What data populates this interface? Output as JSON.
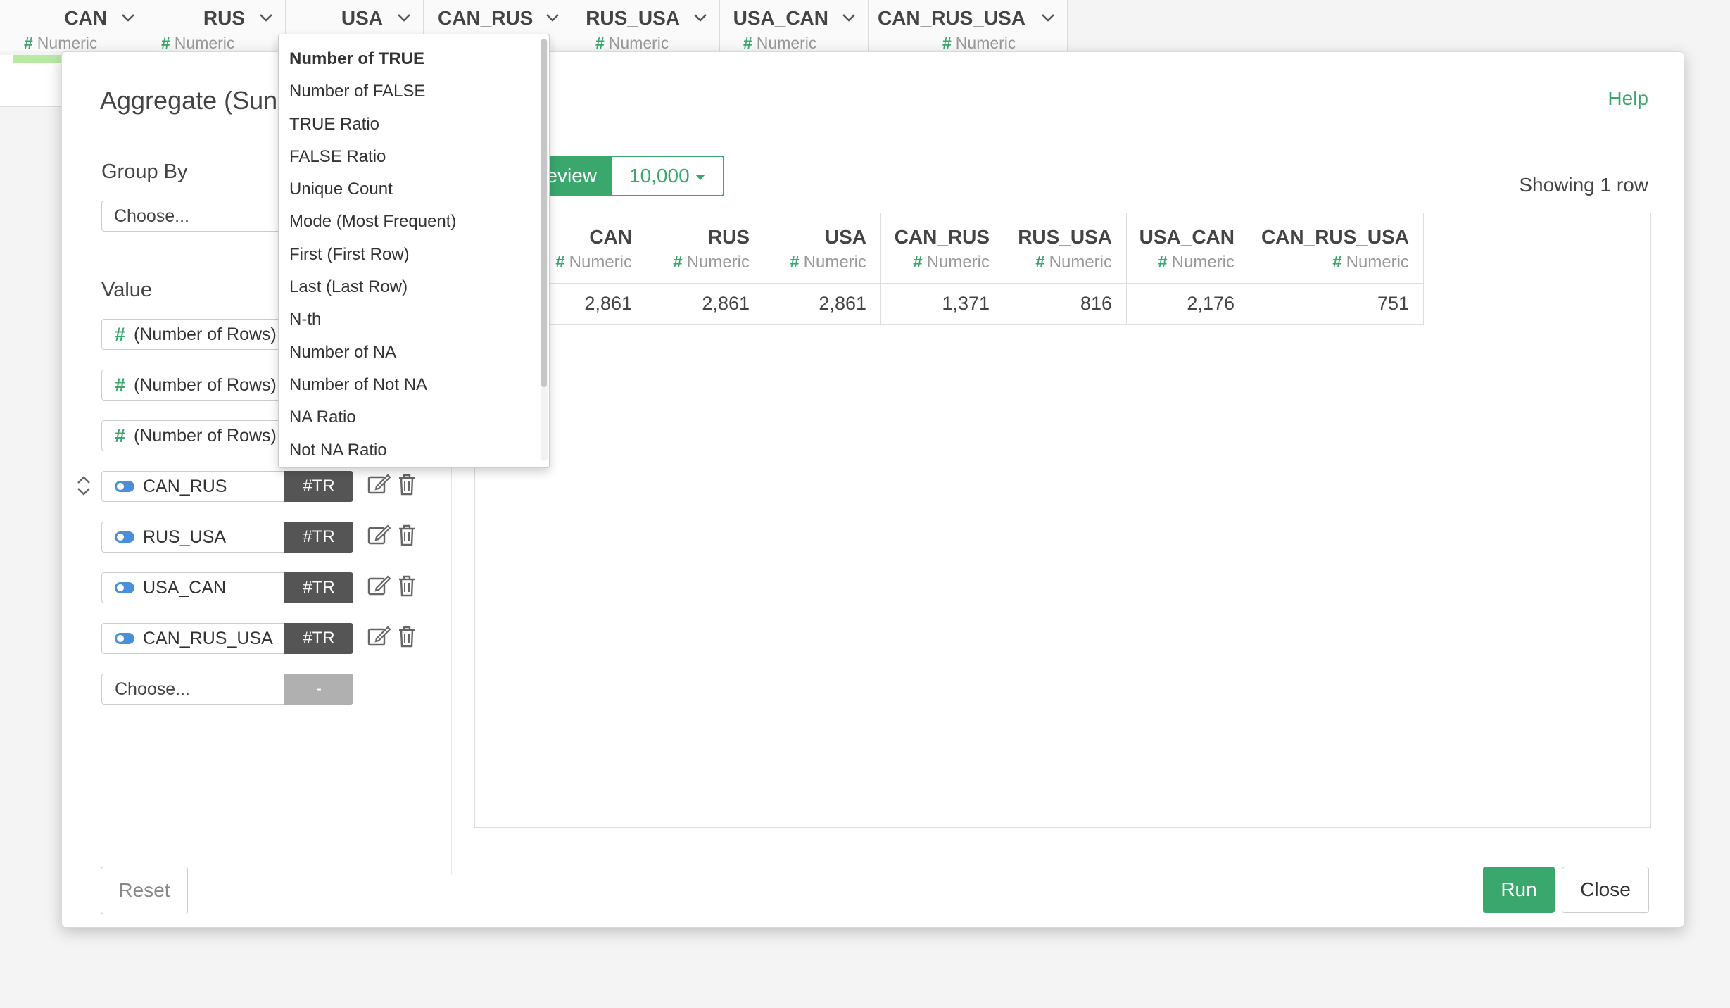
{
  "background_columns": [
    {
      "name": "CAN",
      "type": "Numeric"
    },
    {
      "name": "RUS",
      "type": "Numeric"
    },
    {
      "name": "USA",
      "type": "Numeric"
    },
    {
      "name": "CAN_RUS",
      "type": "Numeric"
    },
    {
      "name": "RUS_USA",
      "type": "Numeric"
    },
    {
      "name": "USA_CAN",
      "type": "Numeric"
    },
    {
      "name": "CAN_RUS_USA",
      "type": "Numeric"
    }
  ],
  "modal": {
    "title": "Aggregate (Sun",
    "help": "Help",
    "group_by_label": "Group By",
    "group_by_placeholder": "Choose...",
    "value_label": "Value",
    "values": [
      {
        "column": "(Number of Rows)",
        "icon": "hash-icon"
      },
      {
        "column": "(Number of Rows)",
        "icon": "hash-icon"
      },
      {
        "column": "(Number of Rows)",
        "icon": "hash-icon"
      },
      {
        "column": "CAN_RUS",
        "op": "#TR",
        "icon": "toggle-icon"
      },
      {
        "column": "RUS_USA",
        "op": "#TR",
        "icon": "toggle-icon"
      },
      {
        "column": "USA_CAN",
        "op": "#TR",
        "icon": "toggle-icon"
      },
      {
        "column": "CAN_RUS_USA",
        "op": "#TR",
        "icon": "toggle-icon"
      }
    ],
    "new_value_placeholder": "Choose...",
    "new_value_op": "-",
    "preview_button": "eview",
    "rows_select": "10,000",
    "showing": "Showing 1 row",
    "preview_columns": [
      {
        "name": "CAN",
        "type": "Numeric",
        "value": "2,861"
      },
      {
        "name": "RUS",
        "type": "Numeric",
        "value": "2,861"
      },
      {
        "name": "USA",
        "type": "Numeric",
        "value": "2,861"
      },
      {
        "name": "CAN_RUS",
        "type": "Numeric",
        "value": "1,371"
      },
      {
        "name": "RUS_USA",
        "type": "Numeric",
        "value": "816"
      },
      {
        "name": "USA_CAN",
        "type": "Numeric",
        "value": "2,176"
      },
      {
        "name": "CAN_RUS_USA",
        "type": "Numeric",
        "value": "751"
      }
    ],
    "reset": "Reset",
    "run": "Run",
    "close": "Close"
  },
  "dropdown": {
    "items": [
      "Number of TRUE",
      "Number of FALSE",
      "TRUE Ratio",
      "FALSE Ratio",
      "Unique Count",
      "Mode (Most Frequent)",
      "First (First Row)",
      "Last (Last Row)",
      "N-th",
      "Number of NA",
      "Number of Not NA",
      "NA Ratio",
      "Not NA Ratio"
    ]
  },
  "colors": {
    "accent": "#3aa76d",
    "operator_bg": "#555555",
    "toggle": "#4a90d9"
  }
}
